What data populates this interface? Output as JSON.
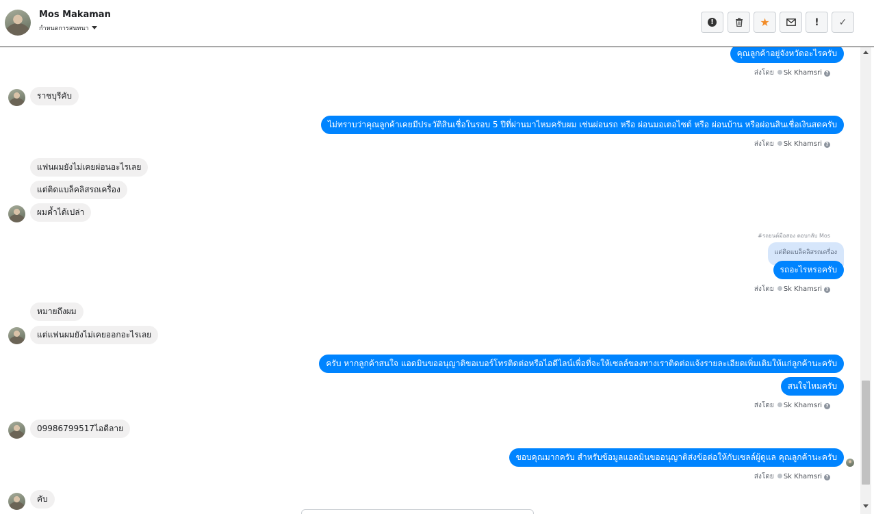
{
  "header": {
    "name": "Mos Makaman",
    "subtitle": "กำหนดการสนทนา",
    "tools": [
      {
        "icon": "alert-circle-icon",
        "glyph": "!"
      },
      {
        "icon": "trash-icon",
        "glyph": "🗑"
      },
      {
        "icon": "star-icon",
        "glyph": "★"
      },
      {
        "icon": "mail-icon",
        "glyph": "✉"
      },
      {
        "icon": "exclamation-icon",
        "glyph": "!"
      },
      {
        "icon": "check-icon",
        "glyph": "✓"
      }
    ]
  },
  "accent_color": "#0084ff",
  "star_color": "#f28c28",
  "sent_by": {
    "prefix": "ส่งโดย",
    "name": "Sk Khamsri",
    "help": "?"
  },
  "messages": {
    "m1": "คุณลูกค้าอยู่จังหวัดอะไรครับ",
    "m2": "ราชบุรีคับ",
    "m3": "ไม่ทราบว่าคุณลูกค้าเคยมีประวัติสินเชื่อในรอบ 5 ปีที่ผ่านมาไหมครับผม เช่นผ่อนรถ หรือ ผ่อนมอเตอไซต์ หรือ ผ่อนบ้าน หรือผ่อนสินเชื่อเงินสดครับ",
    "m4": "แฟนผมยังไม่เคยผ่อนอะไรเลย",
    "m5": "แต่ติดแบล็คลิสรถเครื่อง",
    "m6": "ผมค้ำได้เปล่า",
    "reply_note": "#รถยนต์มือสอง ตอบกลับ Mos",
    "quoted": "แต่ติดแบล็คลิสรถเครื่อง",
    "m7": "รถอะไรหรอครับ",
    "m8": "หมายถึงผม",
    "m9": "แต่แฟนผมยังไม่เคยออกอะไรเลย",
    "m10": "ครับ หากลูกค้าสนใจ แอดมินขออนุญาติขอเบอร์โทรติดต่อหรือไอดีไลน์เพื่อที่จะให้เซลล์ของทางเราติดต่อแจ้งรายละเอียดเพิ่มเติมให้แก่ลูกค้านะครับ",
    "m11": "สนใจไหมครับ",
    "m12": "09986799517ไอดีลาย",
    "m13": "ขอบคุณมากครับ สำหรับข้อมูลแอดมินขออนุญาติส่งข้อต่อให้กับเซลล์ผู้ดูแล คุณลูกค้านะครับ",
    "m14": "คับ"
  }
}
